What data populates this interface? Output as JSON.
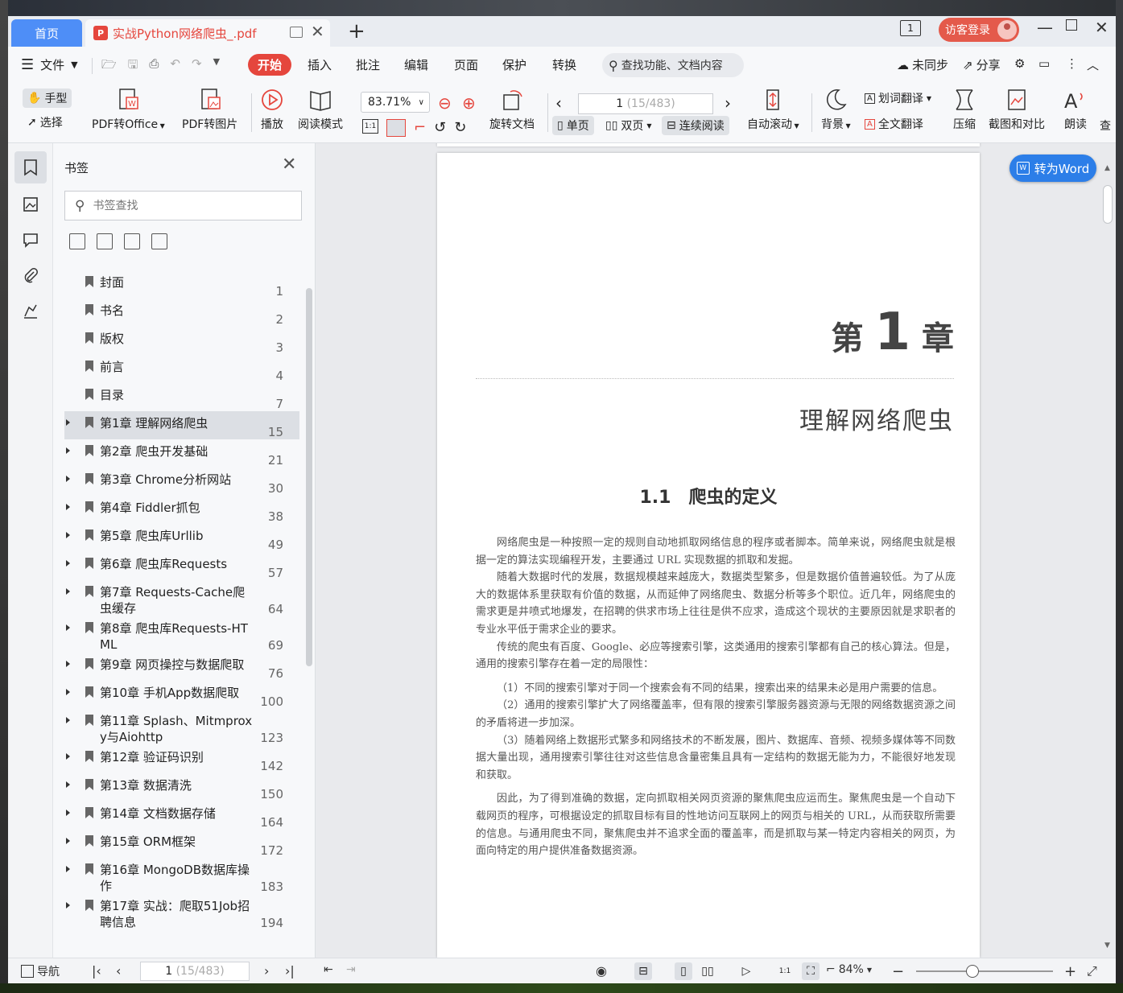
{
  "tabs": {
    "home_label": "首页",
    "doc_title": "实战Python网络爬虫_.pdf"
  },
  "titlebar": {
    "page_indicator": "1",
    "login_label": "访客登录"
  },
  "menu": {
    "file_label": "文件",
    "items": [
      "开始",
      "插入",
      "批注",
      "编辑",
      "页面",
      "保护",
      "转换"
    ],
    "search_label": "查找功能、文档内容",
    "sync_label": "未同步",
    "share_label": "分享"
  },
  "ribbon": {
    "hand": "手型",
    "select": "选择",
    "pdf_to_office": "PDF转Office",
    "pdf_to_image": "PDF转图片",
    "play": "播放",
    "read_mode": "阅读模式",
    "zoom": "83.71%",
    "rotate": "旋转文档",
    "page_current": "1",
    "page_total": "(15/483)",
    "single": "单页",
    "double": "双页",
    "continuous": "连续阅读",
    "auto_scroll": "自动滚动",
    "background": "背景",
    "word_translate": "划词翻译",
    "full_translate": "全文翻译",
    "compress": "压缩",
    "screenshot_compare": "截图和对比",
    "read_aloud": "朗读",
    "more": "查"
  },
  "bookmarks": {
    "title": "书签",
    "search_placeholder": "书签查找",
    "items": [
      {
        "label": "封面",
        "page": "1"
      },
      {
        "label": "书名",
        "page": "2"
      },
      {
        "label": "版权",
        "page": "3"
      },
      {
        "label": "前言",
        "page": "4"
      },
      {
        "label": "目录",
        "page": "7"
      },
      {
        "label": "第1章 理解网络爬虫",
        "page": "15"
      },
      {
        "label": "第2章 爬虫开发基础",
        "page": "21"
      },
      {
        "label": "第3章 Chrome分析网站",
        "page": "30"
      },
      {
        "label": "第4章 Fiddler抓包",
        "page": "38"
      },
      {
        "label": "第5章 爬虫库Urllib",
        "page": "49"
      },
      {
        "label": "第6章 爬虫库Requests",
        "page": "57"
      },
      {
        "label": "第7章 Requests-Cache爬虫缓存",
        "page": "64"
      },
      {
        "label": "第8章 爬虫库Requests-HTML",
        "page": "69"
      },
      {
        "label": "第9章 网页操控与数据爬取",
        "page": "76"
      },
      {
        "label": "第10章 手机App数据爬取",
        "page": "100"
      },
      {
        "label": "第11章 Splash、Mitmproxy与Aiohttp",
        "page": "123"
      },
      {
        "label": "第12章 验证码识别",
        "page": "142"
      },
      {
        "label": "第13章 数据清洗",
        "page": "150"
      },
      {
        "label": "第14章 文档数据存储",
        "page": "164"
      },
      {
        "label": "第15章 ORM框架",
        "page": "172"
      },
      {
        "label": "第16章 MongoDB数据库操作",
        "page": "183"
      },
      {
        "label": "第17章 实战：爬取51Job招聘信息",
        "page": "194"
      }
    ]
  },
  "document": {
    "chapter_prefix": "第",
    "chapter_number": "1",
    "chapter_suffix": "章",
    "chapter_title": "理解网络爬虫",
    "section_title": "1.1　爬虫的定义",
    "paragraphs": [
      "网络爬虫是一种按照一定的规则自动地抓取网络信息的程序或者脚本。简单来说，网络爬虫就是根据一定的算法实现编程开发，主要通过 URL 实现数据的抓取和发掘。",
      "随着大数据时代的发展，数据规模越来越庞大，数据类型繁多，但是数据价值普遍较低。为了从庞大的数据体系里获取有价值的数据，从而延伸了网络爬虫、数据分析等多个职位。近几年，网络爬虫的需求更是井喷式地爆发，在招聘的供求市场上往往是供不应求，造成这个现状的主要原因就是求职者的专业水平低于需求企业的要求。",
      "传统的爬虫有百度、Google、必应等搜索引擎，这类通用的搜索引擎都有自己的核心算法。但是，通用的搜索引擎存在着一定的局限性：",
      "（1）不同的搜索引擎对于同一个搜索会有不同的结果，搜索出来的结果未必是用户需要的信息。",
      "（2）通用的搜索引擎扩大了网络覆盖率，但有限的搜索引擎服务器资源与无限的网络数据资源之间的矛盾将进一步加深。",
      "（3）随着网络上数据形式繁多和网络技术的不断发展，图片、数据库、音频、视频多媒体等不同数据大量出现，通用搜索引擎往往对这些信息含量密集且具有一定结构的数据无能为力，不能很好地发现和获取。",
      "因此，为了得到准确的数据，定向抓取相关网页资源的聚焦爬虫应运而生。聚焦爬虫是一个自动下载网页的程序，可根据设定的抓取目标有目的性地访问互联网上的网页与相关的 URL，从而获取所需要的信息。与通用爬虫不同，聚焦爬虫并不追求全面的覆盖率，而是抓取与某一特定内容相关的网页，为面向特定的用户提供准备数据资源。"
    ],
    "to_word_label": "转为Word"
  },
  "statusbar": {
    "nav_label": "导航",
    "page_current": "1",
    "page_total": "(15/483)",
    "zoom": "84%"
  }
}
